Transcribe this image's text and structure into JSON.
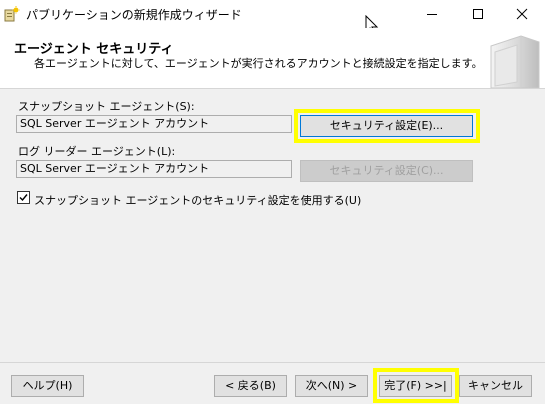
{
  "window": {
    "title": "パブリケーションの新規作成ウィザード",
    "app_icon": "wizard-icon"
  },
  "header": {
    "title": "エージェント セキュリティ",
    "description": "各エージェントに対して、エージェントが実行されるアカウントと接続設定を指定します。"
  },
  "snapshot_agent": {
    "label": "スナップショット エージェント(S):",
    "value": "SQL Server エージェント アカウント",
    "button_label": "セキュリティ設定(E)..."
  },
  "log_reader_agent": {
    "label": "ログ リーダー エージェント(L):",
    "value": "SQL Server エージェント アカウント",
    "button_label": "セキュリティ設定(C)..."
  },
  "checkbox": {
    "label": "スナップショット エージェントのセキュリティ設定を使用する(U)",
    "checked": true
  },
  "footer": {
    "help_label": "ヘルプ(H)",
    "back_label": "< 戻る(B)",
    "next_label": "次へ(N) >",
    "finish_label": "完了(F) >>|",
    "cancel_label": "キャンセル"
  },
  "colors": {
    "highlight": "#ffff00",
    "focus_border": "#0078d7"
  }
}
